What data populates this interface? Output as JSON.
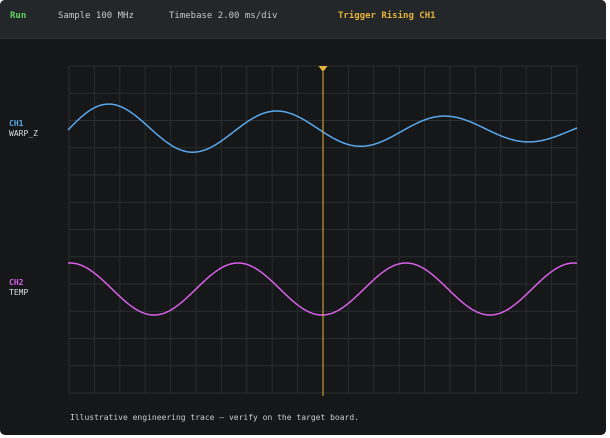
{
  "status": {
    "run_label": "Run",
    "sample": "Sample 100 MHz",
    "timebase": "Timebase 2.00 ms/div",
    "trigger": "Trigger Rising CH1"
  },
  "channels": [
    {
      "id": "CH1",
      "signal": "WARP_Z",
      "color": "#5aa8ec"
    },
    {
      "id": "CH2",
      "signal": "TEMP",
      "color": "#d760e8"
    }
  ],
  "footer_note": "Illustrative engineering trace — verify on the target board.",
  "colors": {
    "run": "#5fd35f",
    "trigger": "#e6b33a",
    "background": "#151718",
    "grid": "#2a2e31"
  }
}
